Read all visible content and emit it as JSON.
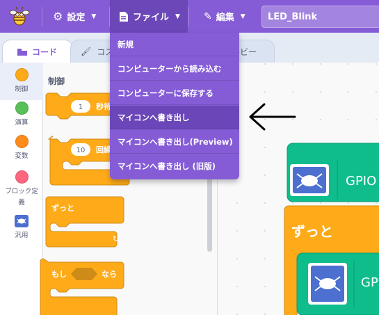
{
  "header": {
    "settings_label": "設定",
    "file_label": "ファイル",
    "edit_label": "編集",
    "project_name": "LED_Blink"
  },
  "tabs": [
    {
      "label": "コード"
    },
    {
      "label": "コス"
    },
    {
      "label": "ルビー"
    }
  ],
  "categories": [
    {
      "label": "制御",
      "color": "#ffab19"
    },
    {
      "label": "演算",
      "color": "#59c059"
    },
    {
      "label": "変数",
      "color": "#ff8c1a"
    },
    {
      "label_line1": "ブロック定",
      "label_line2": "義",
      "color": "#ff6680"
    },
    {
      "label": "汎用",
      "color": "#4c6fd0"
    }
  ],
  "palette": {
    "heading": "制御",
    "blocks": [
      {
        "value": "1",
        "text": "秒待"
      },
      {
        "value": "10",
        "text": "回繰"
      },
      {
        "text": "ずっと"
      },
      {
        "text_if": "もし",
        "text_then": "なら"
      }
    ]
  },
  "file_menu": {
    "items": [
      {
        "label": "新規"
      },
      {
        "label": "コンピューターから読み込む"
      },
      {
        "label": "コンピューターに保存する"
      },
      {
        "label": "マイコンへ書き出し"
      },
      {
        "label": "マイコンへ書き出し(Preview)"
      },
      {
        "label": "マイコンへ書き出し (旧版)"
      }
    ],
    "highlighted_index": 3
  },
  "code_area": {
    "gpio_label": "GPIO",
    "forever_label": "ずっと",
    "inner_label": "GP"
  },
  "colors": {
    "accent": "#855cd6",
    "control": "#ffab19",
    "extension": "#0fbd8c"
  }
}
